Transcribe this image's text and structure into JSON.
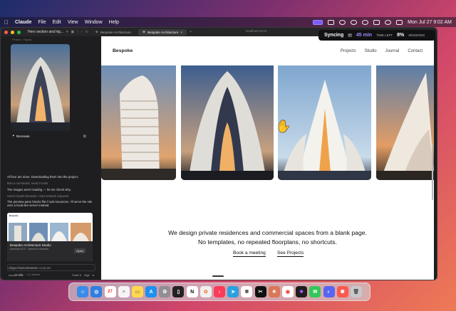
{
  "menubar": {
    "app_name": "Claude",
    "menus": [
      "File",
      "Edit",
      "View",
      "Window",
      "Help"
    ],
    "clock": "Mon Jul 27  9:02 AM"
  },
  "window": {
    "session_title": "Hero section and hig...",
    "tabs": [
      "Bespoke Architecture",
      "Bespoke Architecture"
    ],
    "address": "localhost:4173"
  },
  "sync_widget": {
    "label": "Syncing",
    "duration": "45 min",
    "duration_sub": "TIME LEFT",
    "percent": "8%",
    "percent_sub": "SESSIONS"
  },
  "left_panel": {
    "header": "Photos · Figma",
    "recreate_label": "Recreate",
    "messages": [
      "All four are done. Downloading them into the project.",
      "Ran a command, used 3 tools",
      "The images aren't loading — let me check why.",
      "Used Claude Browser: read network requests",
      "The preview pane blocks file:// sub-resources. I'll serve the site over a local dev server instead."
    ],
    "card": {
      "brand": "Bespoke",
      "title": "Bespoke Architecture Studio",
      "subtitle": "localhost:4173 · Opened in Browser",
      "open_label": "Open"
    },
    "using_line": "Using Claude Browser computer",
    "timer_line": "1m 45s · ↑ 7.1 tokens",
    "input_placeholder": "Type / for commands",
    "footer_left": "Accept edits",
    "footer_right": [
      "Fable 5",
      "High"
    ]
  },
  "site": {
    "brand": "Bespoke",
    "nav": [
      "Projects",
      "Studio",
      "Journal",
      "Contact"
    ],
    "tagline_1": "We design private residences and commercial spaces from a blank page.",
    "tagline_2": "No templates, no repeated floorplans, no shortcuts.",
    "cta_primary": "Book a meeting",
    "cta_secondary": "See Projects"
  },
  "dock_apps": [
    "finder",
    "safari",
    "calendar",
    "reminders",
    "notes",
    "app-store",
    "settings",
    "terminal",
    "notion",
    "photos",
    "music",
    "telegram",
    "chatgpt",
    "capcut",
    "claude",
    "chrome",
    "figma",
    "messages",
    "discord",
    "arc",
    "trash"
  ],
  "colors": {
    "accent": "#7b5cff",
    "sync_minutes": "#9e89ff",
    "window_bg": "#1f1f21"
  }
}
